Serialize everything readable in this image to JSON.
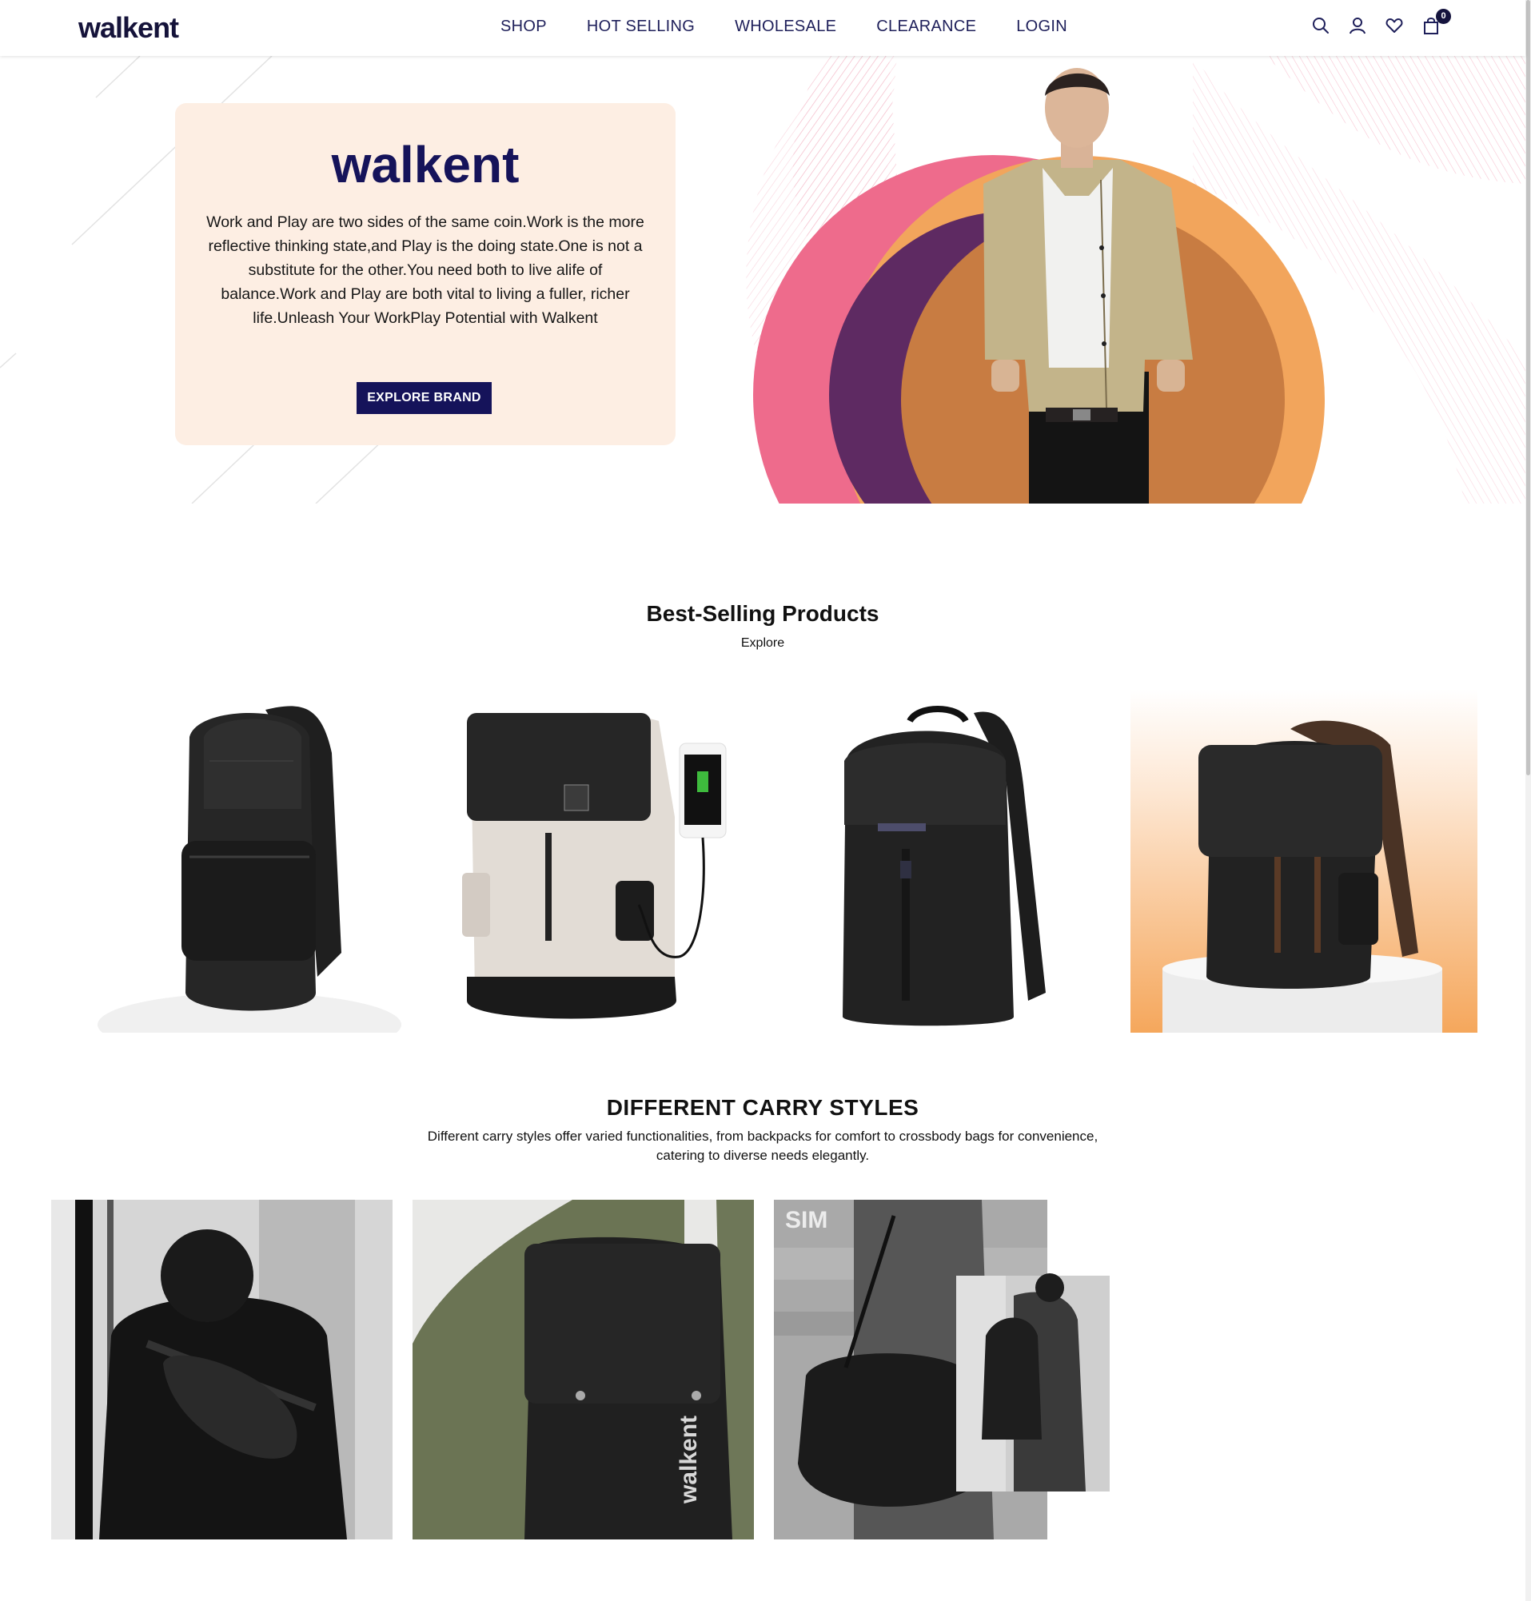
{
  "header": {
    "logo": "walkent",
    "nav": [
      "SHOP",
      "HOT SELLING",
      "WHOLESALE",
      "CLEARANCE",
      "LOGIN"
    ],
    "icons": [
      "search-icon",
      "user-icon",
      "heart-icon",
      "cart-icon"
    ],
    "cart_count": "0"
  },
  "hero": {
    "title": "walkent",
    "text": "Work and Play are two sides of the same coin.Work is the more reflective thinking state,and Play is the doing state.One is not a substitute for the other.You need both to live alife of balance.Work and Play are both vital to living a fuller, richer life.Unleash Your WorkPlay Potential with Walkent",
    "button": "EXPLORE BRAND"
  },
  "best_selling": {
    "title": "Best-Selling Products",
    "subtitle": "Explore"
  },
  "carry_styles": {
    "title": "DIFFERENT CARRY STYLES",
    "description_line1": "Different carry styles offer varied functionalities, from backpacks for comfort to crossbody bags for convenience,",
    "description_line2": "catering to diverse needs elegantly.",
    "bag_brand_text": "walkent",
    "bg_sign_text": "SIM"
  },
  "colors": {
    "brand_navy": "#15135a",
    "hero_card": "#fdeee3",
    "pink": "#ee6b8c",
    "purple": "#5e2a62",
    "orange": "#f2a55c"
  }
}
